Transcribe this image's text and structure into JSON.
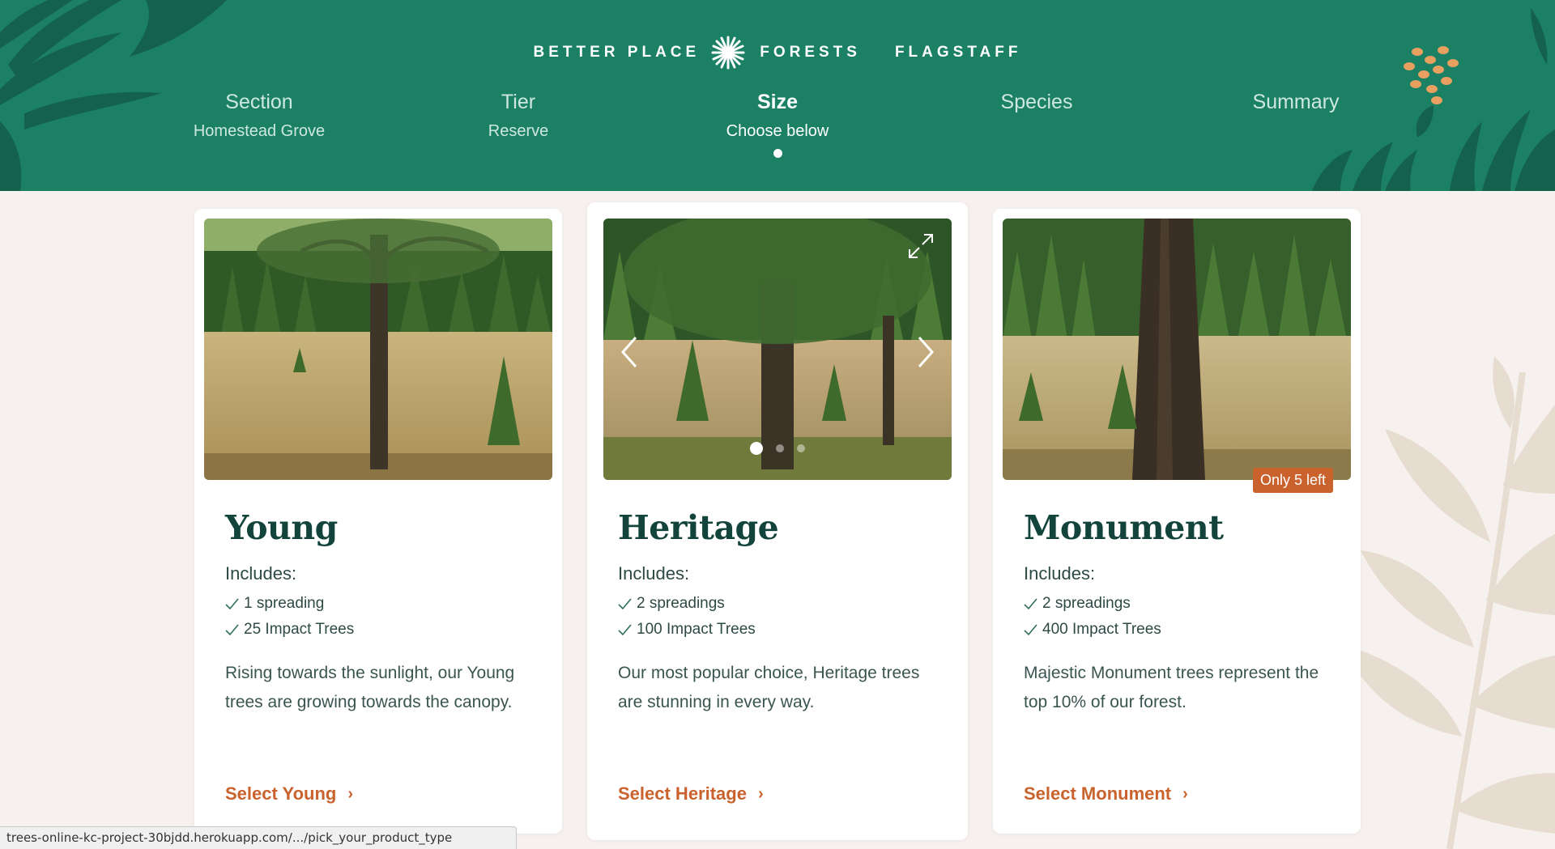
{
  "brand": {
    "left": "BETTER PLACE",
    "right": "FORESTS",
    "location": "FLAGSTAFF",
    "logo_icon": "starburst-logo-icon"
  },
  "steps": [
    {
      "title": "Section",
      "subtitle": "Homestead Grove",
      "active": false
    },
    {
      "title": "Tier",
      "subtitle": "Reserve",
      "active": false
    },
    {
      "title": "Size",
      "subtitle": "Choose below",
      "active": true
    },
    {
      "title": "Species",
      "subtitle": "",
      "active": false
    },
    {
      "title": "Summary",
      "subtitle": "",
      "active": false
    }
  ],
  "cards": [
    {
      "title": "Young",
      "includes_label": "Includes:",
      "includes": [
        "1 spreading",
        "25 Impact Trees"
      ],
      "description": "Rising towards the sunlight, our Young trees are growing towards the canopy.",
      "cta": "Select Young",
      "badge": ""
    },
    {
      "title": "Heritage",
      "includes_label": "Includes:",
      "includes": [
        "2 spreadings",
        "100 Impact Trees"
      ],
      "description": "Our most popular choice, Heritage trees are stunning in every way.",
      "cta": "Select Heritage",
      "badge": "",
      "carousel": {
        "slides": 3,
        "active_slide": 1
      }
    },
    {
      "title": "Monument",
      "includes_label": "Includes:",
      "includes": [
        "2 spreadings",
        "400 Impact Trees"
      ],
      "description": "Majestic Monument trees represent the top 10% of our forest.",
      "cta": "Select Monument",
      "badge": "Only 5 left"
    }
  ],
  "status_url": "trees-online-kc-project-30bjdd.herokuapp.com/.../pick_your_product_type",
  "colors": {
    "header_bg": "#1b8064",
    "page_bg": "#f6f1ee",
    "accent": "#c9622d",
    "title": "#12443c"
  }
}
